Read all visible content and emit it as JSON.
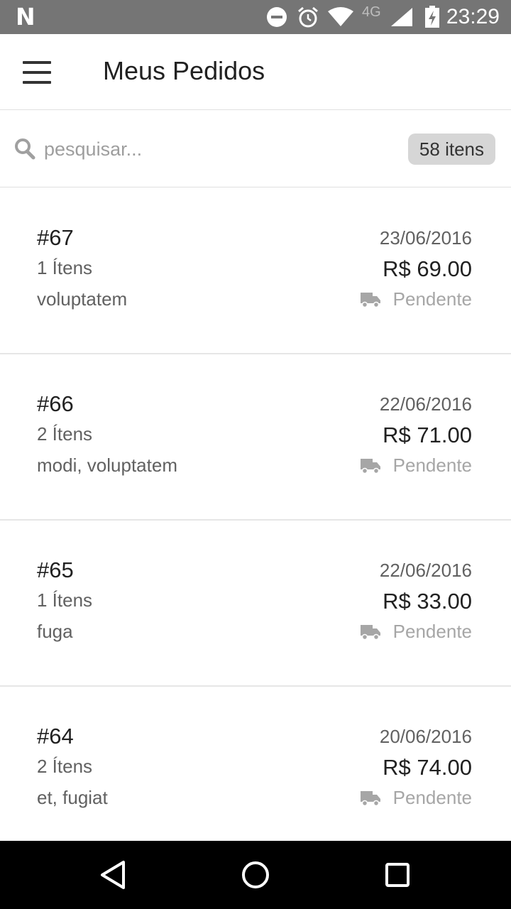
{
  "status_bar": {
    "time": "23:29",
    "network": "4G",
    "app_notification": "N"
  },
  "header": {
    "title": "Meus Pedidos"
  },
  "search": {
    "placeholder": "pesquisar...",
    "count_badge": "58 itens"
  },
  "orders": [
    {
      "number": "#67",
      "items": "1 Ítens",
      "description": "voluptatem",
      "date": "23/06/2016",
      "price": "R$ 69.00",
      "status": "Pendente"
    },
    {
      "number": "#66",
      "items": "2 Ítens",
      "description": "modi, voluptatem",
      "date": "22/06/2016",
      "price": "R$ 71.00",
      "status": "Pendente"
    },
    {
      "number": "#65",
      "items": "1 Ítens",
      "description": "fuga",
      "date": "22/06/2016",
      "price": "R$ 33.00",
      "status": "Pendente"
    },
    {
      "number": "#64",
      "items": "2 Ítens",
      "description": "et, fugiat",
      "date": "20/06/2016",
      "price": "R$ 74.00",
      "status": "Pendente"
    }
  ],
  "icons": {
    "menu": "hamburger-menu-icon",
    "search": "search-icon",
    "status": "truck-icon",
    "nav_back": "back-triangle-icon",
    "nav_home": "home-circle-icon",
    "nav_recents": "recents-square-icon"
  },
  "colors": {
    "status_bar": "#757575",
    "nav_bar": "#000000",
    "badge": "#d6d6d6",
    "pending": "#a6a6a6"
  }
}
